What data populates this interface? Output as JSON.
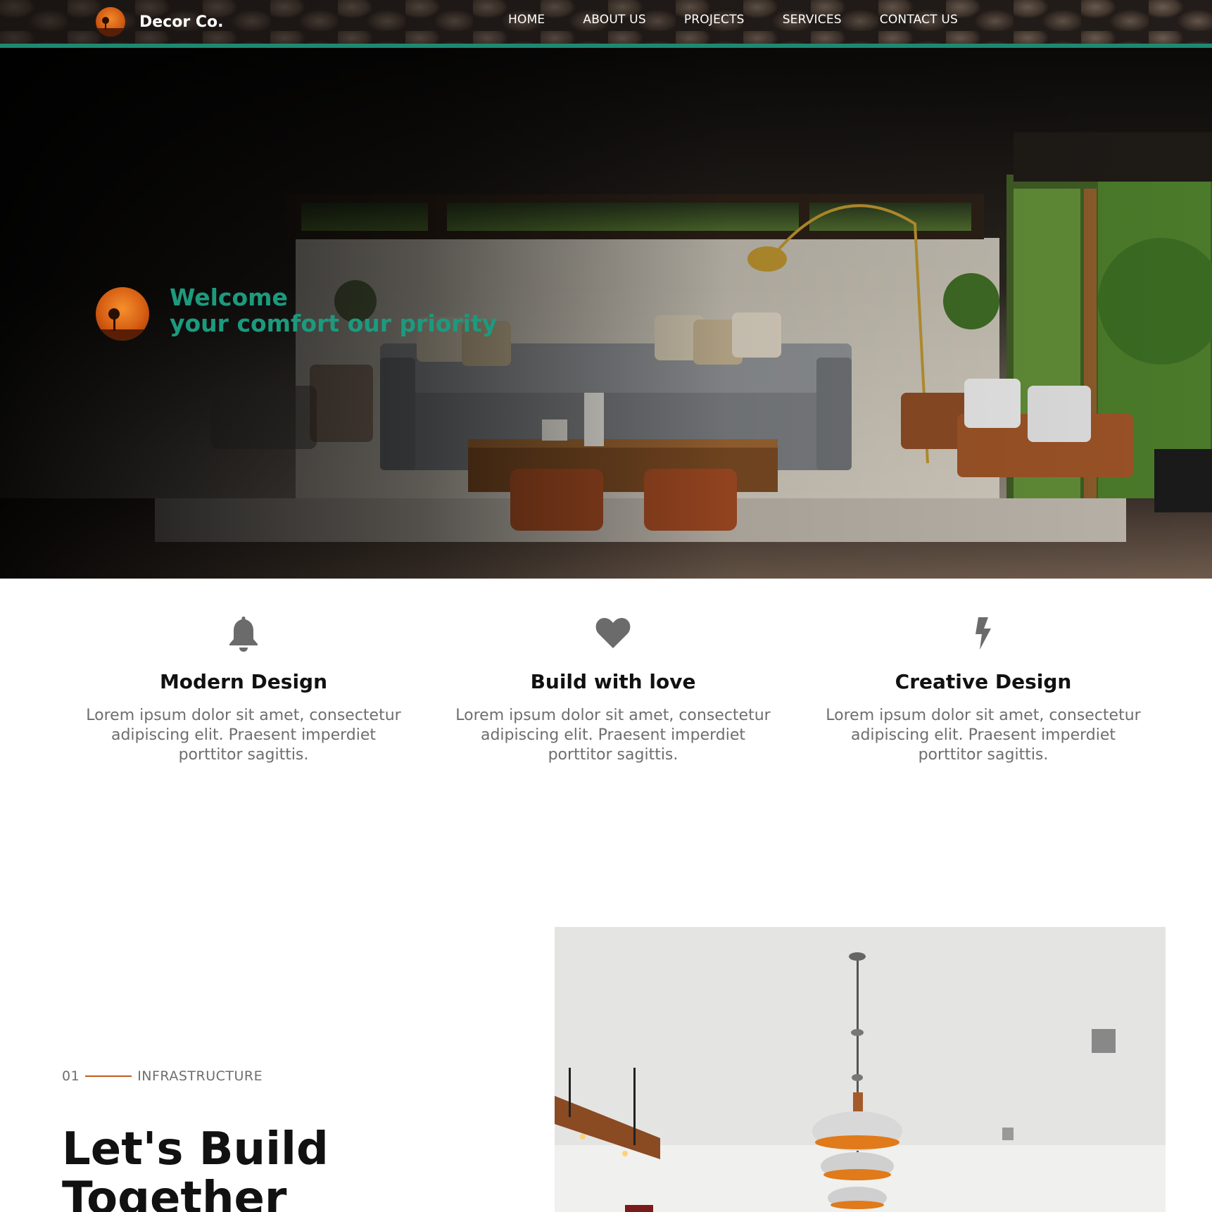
{
  "brand": {
    "name": "Decor Co."
  },
  "nav": {
    "items": [
      "HOME",
      "ABOUT US",
      "PROJECTS",
      "SERVICES",
      "CONTACT US"
    ]
  },
  "hero": {
    "line1": "Welcome",
    "line2": "your comfort our priority"
  },
  "features": [
    {
      "icon": "bell-icon",
      "title": "Modern Design",
      "text": "Lorem ipsum dolor sit amet, consectetur adipiscing elit. Praesent imperdiet porttitor sagittis."
    },
    {
      "icon": "heart-icon",
      "title": "Build with love",
      "text": "Lorem ipsum dolor sit amet, consectetur adipiscing elit. Praesent imperdiet porttitor sagittis."
    },
    {
      "icon": "lightning-icon",
      "title": "Creative Design",
      "text": "Lorem ipsum dolor sit amet, consectetur adipiscing elit. Praesent imperdiet porttitor sagittis."
    }
  ],
  "infrastructure": {
    "number": "01",
    "label": "INFRASTRUCTURE",
    "heading": "Let's Build Together"
  },
  "colors": {
    "accent": "#1c8a72",
    "accent_text": "#1c9a7e",
    "orange": "#c25a1c"
  }
}
